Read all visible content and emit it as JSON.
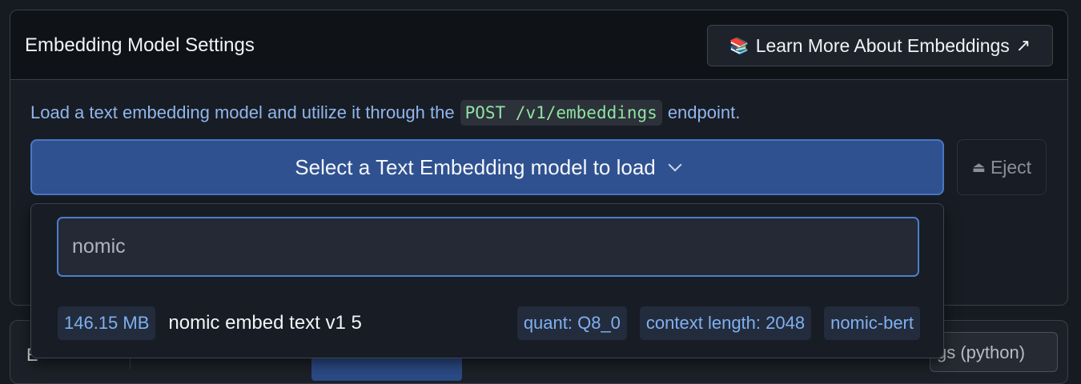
{
  "header": {
    "title": "Embedding Model Settings",
    "learn_icon": "books-emoji",
    "learn_label": "Learn More About Embeddings",
    "learn_arrow": "↗"
  },
  "body": {
    "desc_before": "Load a text embedding model and utilize it through the",
    "desc_code": "POST /v1/embeddings",
    "desc_after": "endpoint.",
    "select_label": "Select a Text Embedding model to load",
    "eject_label": "Eject"
  },
  "dropdown": {
    "search_value": "nomic",
    "results": [
      {
        "size": "146.15 MB",
        "name": "nomic embed text v1 5",
        "quant": "quant: Q8_0",
        "context": "context length: 2048",
        "arch": "nomic-bert"
      }
    ]
  },
  "bottom": {
    "left_tab": "E",
    "right_tab": "gs (python)"
  },
  "colors": {
    "accent": "#2f5190",
    "accent_border": "#4a76c5",
    "tag_text": "#7fb0f0",
    "code_text": "#8fe3a0"
  }
}
